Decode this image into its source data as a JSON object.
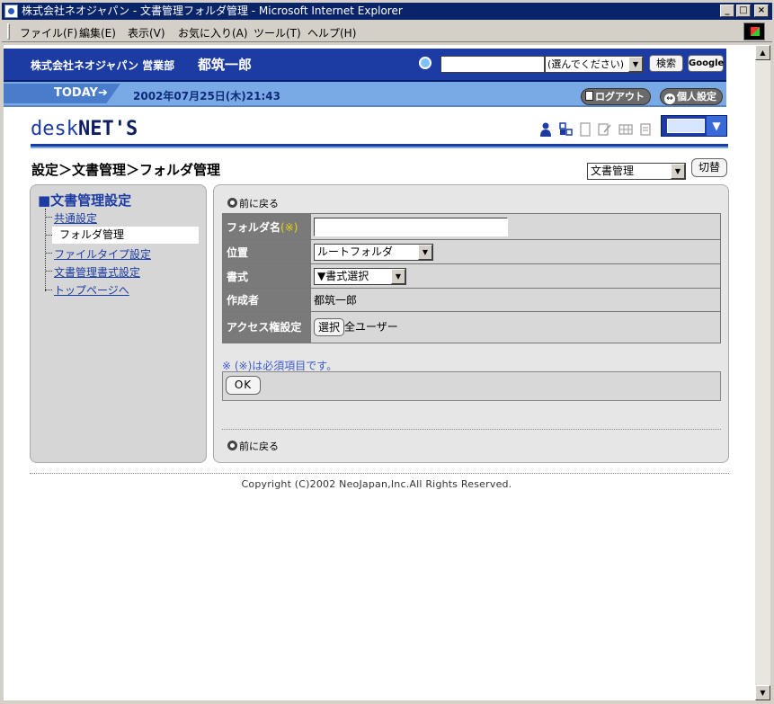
{
  "window": {
    "title": "株式会社ネオジャパン - 文書管理フォルダ管理 - Microsoft Internet Explorer",
    "controls": {
      "minimize": "_",
      "maximize": "□",
      "close": "×"
    }
  },
  "menubar": {
    "items": [
      "ファイル(F)",
      "編集(E)",
      "表示(V)",
      "お気に入り(A)",
      "ツール(T)",
      "ヘルプ(H)"
    ]
  },
  "header": {
    "company": "株式会社ネオジャパン 営業部",
    "user": "都筑一郎",
    "search_placeholder": "",
    "search_scope": "(選んでください)",
    "search_button": "検索",
    "google_button": "Google"
  },
  "todaybar": {
    "today_label": "TODAY➔",
    "date": "2002年07月25日(木)21:43",
    "logout": "ログアウト",
    "personal_settings": "個人設定"
  },
  "logo": {
    "part1": "desk",
    "part2": "NET'S"
  },
  "breadcrumb": "設定＞文書管理＞フォルダ管理",
  "mode_select": {
    "value": "文書管理",
    "switch_button": "切替"
  },
  "sidebar": {
    "title": "■文書管理設定",
    "items": [
      {
        "label": "共通設定",
        "selected": false
      },
      {
        "label": "フォルダ管理",
        "selected": true
      },
      {
        "label": "ファイルタイプ設定",
        "selected": false
      },
      {
        "label": "文書管理書式設定",
        "selected": false
      },
      {
        "label": "トップページへ",
        "selected": false
      }
    ]
  },
  "main": {
    "back_top": "前に戻る",
    "back_bottom": "前に戻る",
    "form": {
      "folder_name_label": "フォルダ名",
      "required_mark": "(※)",
      "folder_name_value": "",
      "location_label": "位置",
      "location_value": "ルートフォルダ",
      "format_label": "書式",
      "format_value": "▼書式選択",
      "creator_label": "作成者",
      "creator_value": "都筑一郎",
      "access_label": "アクセス権設定",
      "access_button": "選択",
      "access_value": "全ユーザー"
    },
    "note": "※ (※)は必須項目です。",
    "ok_button": "OK"
  },
  "footer": {
    "copyright": "Copyright (C)2002 NeoJapan,Inc.All Rights Reserved."
  }
}
